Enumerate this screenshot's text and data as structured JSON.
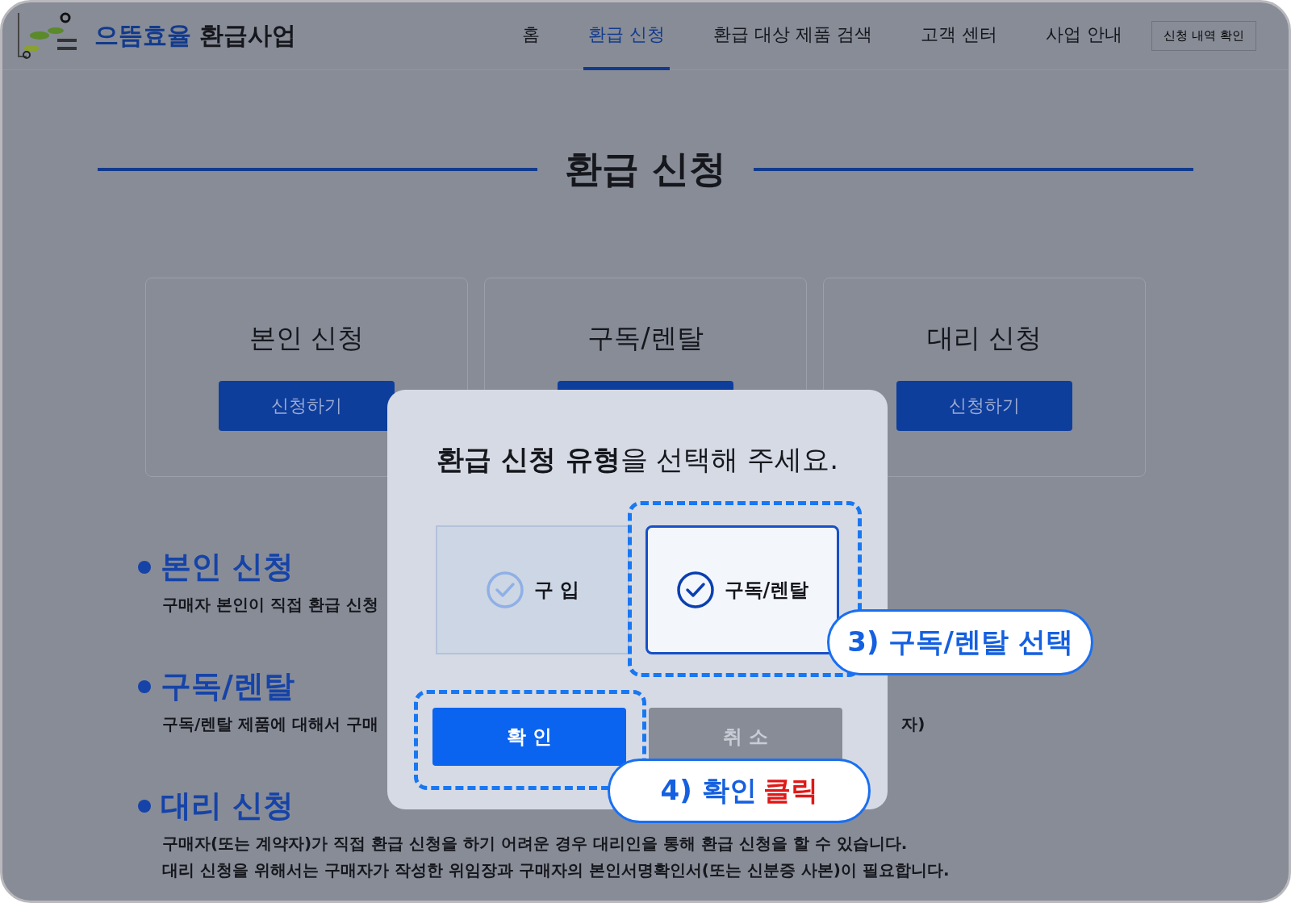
{
  "header": {
    "logo_text_accent": "으뜸효율",
    "logo_text": "환급사업",
    "nav": [
      {
        "label": "홈",
        "selected": false
      },
      {
        "label": "환급 신청",
        "selected": true
      },
      {
        "label": "환급 대상 제품 검색",
        "selected": false
      },
      {
        "label": "고객 센터",
        "selected": false
      },
      {
        "label": "사업 안내",
        "selected": false
      }
    ],
    "history_button": "신청 내역 확인"
  },
  "page_title": "환급 신청",
  "cards": [
    {
      "title": "본인 신청",
      "button": "신청하기"
    },
    {
      "title": "구독/렌탈"
    },
    {
      "title": "대리 신청",
      "button": "신청하기"
    }
  ],
  "sections": [
    {
      "heading": "본인 신청",
      "lines": [
        {
          "text": "구매자 본인이 직접 환급 신청"
        }
      ]
    },
    {
      "heading": "구독/렌탈",
      "lines": [
        {
          "text": "구독/렌탈 제품에 대해서 구매",
          "text_after_modal": "자)"
        }
      ]
    },
    {
      "heading": "대리 신청",
      "lines": [
        {
          "text": "구매자(또는 계약자)가 직접 환급 신청을 하기 어려운 경우 대리인을 통해 환급 신청을 할 수 있습니다."
        },
        {
          "text": "대리 신청을 위해서는 구매자가 작성한 위임장과 구매자의 본인서명확인서(또는 신분증 사본)이 필요합니다."
        }
      ]
    }
  ],
  "modal": {
    "title": "**환급 신청 유형**을 선택해 주세요.",
    "options": [
      {
        "label": "구 입",
        "selected": false
      },
      {
        "label": "구독/렌탈",
        "selected": true
      }
    ],
    "buttons": [
      {
        "label": "확 인",
        "kind": "primary"
      },
      {
        "label": "취 소",
        "kind": "secondary"
      }
    ]
  },
  "callouts": [
    {
      "kind": "option",
      "segments": [
        {
          "text": "3) 구독/렌탈 선택",
          "kind": "plain"
        }
      ]
    },
    {
      "kind": "button",
      "segments": [
        {
          "text": "4) 확인",
          "kind": "plain"
        },
        {
          "text": "클릭",
          "kind": "emphasis"
        }
      ]
    }
  ]
}
